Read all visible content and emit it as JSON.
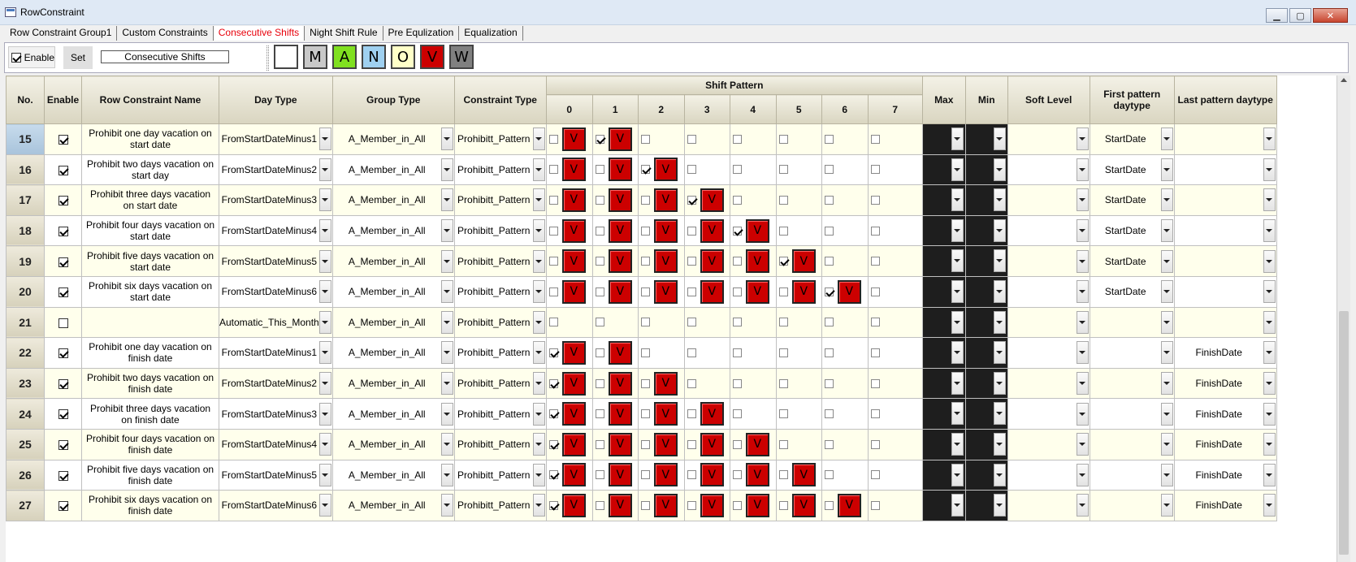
{
  "window": {
    "title": "RowConstraint",
    "minimize": "▁",
    "maximize": "▢",
    "close": "✕"
  },
  "tabs": [
    "Row Constraint Group1",
    "Custom Constraints",
    "Consecutive Shifts",
    "Night Shift Rule",
    "Pre Equlization",
    "Equalization"
  ],
  "active_tab": 2,
  "toolbar": {
    "enable_label": "Enable",
    "enable_checked": true,
    "set_label": "Set",
    "name_value": "Consecutive Shifts",
    "shift_buttons": [
      {
        "label": "",
        "color": "#ffffff"
      },
      {
        "label": "M",
        "color": "#c8c8c8"
      },
      {
        "label": "A",
        "color": "#80e020"
      },
      {
        "label": "N",
        "color": "#9fd0f0"
      },
      {
        "label": "O",
        "color": "#ffffc8"
      },
      {
        "label": "V",
        "color": "#cc0000"
      },
      {
        "label": "W",
        "color": "#808080"
      }
    ]
  },
  "columns": {
    "no": "No.",
    "enable": "Enable",
    "name": "Row Constraint Name",
    "day_type": "Day Type",
    "group_type": "Group Type",
    "constraint_type": "Constraint Type",
    "shift_pattern": "Shift Pattern",
    "pattern_indices": [
      "0",
      "1",
      "2",
      "3",
      "4",
      "5",
      "6",
      "7"
    ],
    "max": "Max",
    "min": "Min",
    "soft_level": "Soft Level",
    "first_pattern": "First pattern daytype",
    "last_pattern": "Last pattern daytype"
  },
  "rows": [
    {
      "no": "15",
      "enable": true,
      "name": "Prohibit one day vacation on start date",
      "day_type": "FromStartDateMinus1",
      "group": "A_Member_in_All",
      "ctype": "Prohibitt_Pattern",
      "checks": [
        false,
        true,
        false,
        false,
        false,
        false,
        false,
        false
      ],
      "vs": [
        true,
        true,
        false,
        false,
        false,
        false,
        false,
        false
      ],
      "first": "StartDate",
      "last": "",
      "selected": true
    },
    {
      "no": "16",
      "enable": true,
      "name": "Prohibit two days vacation on start day",
      "day_type": "FromStartDateMinus2",
      "group": "A_Member_in_All",
      "ctype": "Prohibitt_Pattern",
      "checks": [
        false,
        false,
        true,
        false,
        false,
        false,
        false,
        false
      ],
      "vs": [
        true,
        true,
        true,
        false,
        false,
        false,
        false,
        false
      ],
      "first": "StartDate",
      "last": ""
    },
    {
      "no": "17",
      "enable": true,
      "name": "Prohibit three days vacation on start date",
      "day_type": "FromStartDateMinus3",
      "group": "A_Member_in_All",
      "ctype": "Prohibitt_Pattern",
      "checks": [
        false,
        false,
        false,
        true,
        false,
        false,
        false,
        false
      ],
      "vs": [
        true,
        true,
        true,
        true,
        false,
        false,
        false,
        false
      ],
      "first": "StartDate",
      "last": ""
    },
    {
      "no": "18",
      "enable": true,
      "name": "Prohibit four days vacation on start date",
      "day_type": "FromStartDateMinus4",
      "group": "A_Member_in_All",
      "ctype": "Prohibitt_Pattern",
      "checks": [
        false,
        false,
        false,
        false,
        true,
        false,
        false,
        false
      ],
      "vs": [
        true,
        true,
        true,
        true,
        true,
        false,
        false,
        false
      ],
      "first": "StartDate",
      "last": ""
    },
    {
      "no": "19",
      "enable": true,
      "name": "Prohibit five days vacation on start date",
      "day_type": "FromStartDateMinus5",
      "group": "A_Member_in_All",
      "ctype": "Prohibitt_Pattern",
      "checks": [
        false,
        false,
        false,
        false,
        false,
        true,
        false,
        false
      ],
      "vs": [
        true,
        true,
        true,
        true,
        true,
        true,
        false,
        false
      ],
      "first": "StartDate",
      "last": ""
    },
    {
      "no": "20",
      "enable": true,
      "name": "Prohibit six days vacation on start date",
      "day_type": "FromStartDateMinus6",
      "group": "A_Member_in_All",
      "ctype": "Prohibitt_Pattern",
      "checks": [
        false,
        false,
        false,
        false,
        false,
        false,
        true,
        false
      ],
      "vs": [
        true,
        true,
        true,
        true,
        true,
        true,
        true,
        false
      ],
      "first": "StartDate",
      "last": ""
    },
    {
      "no": "21",
      "enable": false,
      "name": "",
      "day_type": "Automatic_This_Month",
      "group": "A_Member_in_All",
      "ctype": "Prohibitt_Pattern",
      "checks": [
        false,
        false,
        false,
        false,
        false,
        false,
        false,
        false
      ],
      "vs": [
        false,
        false,
        false,
        false,
        false,
        false,
        false,
        false
      ],
      "first": "",
      "last": ""
    },
    {
      "no": "22",
      "enable": true,
      "name": "Prohibit one day vacation on finish date",
      "day_type": "FromStartDateMinus1",
      "group": "A_Member_in_All",
      "ctype": "Prohibitt_Pattern",
      "checks": [
        true,
        false,
        false,
        false,
        false,
        false,
        false,
        false
      ],
      "vs": [
        true,
        true,
        false,
        false,
        false,
        false,
        false,
        false
      ],
      "first": "",
      "last": "FinishDate"
    },
    {
      "no": "23",
      "enable": true,
      "name": "Prohibit two days vacation on finish date",
      "day_type": "FromStartDateMinus2",
      "group": "A_Member_in_All",
      "ctype": "Prohibitt_Pattern",
      "checks": [
        true,
        false,
        false,
        false,
        false,
        false,
        false,
        false
      ],
      "vs": [
        true,
        true,
        true,
        false,
        false,
        false,
        false,
        false
      ],
      "first": "",
      "last": "FinishDate"
    },
    {
      "no": "24",
      "enable": true,
      "name": "Prohibit three days vacation on finish date",
      "day_type": "FromStartDateMinus3",
      "group": "A_Member_in_All",
      "ctype": "Prohibitt_Pattern",
      "checks": [
        true,
        false,
        false,
        false,
        false,
        false,
        false,
        false
      ],
      "vs": [
        true,
        true,
        true,
        true,
        false,
        false,
        false,
        false
      ],
      "first": "",
      "last": "FinishDate"
    },
    {
      "no": "25",
      "enable": true,
      "name": "Prohibit four days vacation on finish date",
      "day_type": "FromStartDateMinus4",
      "group": "A_Member_in_All",
      "ctype": "Prohibitt_Pattern",
      "checks": [
        true,
        false,
        false,
        false,
        false,
        false,
        false,
        false
      ],
      "vs": [
        true,
        true,
        true,
        true,
        true,
        false,
        false,
        false
      ],
      "first": "",
      "last": "FinishDate"
    },
    {
      "no": "26",
      "enable": true,
      "name": "Prohibit five days vacation on finish date",
      "day_type": "FromStartDateMinus5",
      "group": "A_Member_in_All",
      "ctype": "Prohibitt_Pattern",
      "checks": [
        true,
        false,
        false,
        false,
        false,
        false,
        false,
        false
      ],
      "vs": [
        true,
        true,
        true,
        true,
        true,
        true,
        false,
        false
      ],
      "first": "",
      "last": "FinishDate"
    },
    {
      "no": "27",
      "enable": true,
      "name": "Prohibit six days vacation on finish date",
      "day_type": "FromStartDateMinus6",
      "group": "A_Member_in_All",
      "ctype": "Prohibitt_Pattern",
      "checks": [
        true,
        false,
        false,
        false,
        false,
        false,
        false,
        false
      ],
      "vs": [
        true,
        true,
        true,
        true,
        true,
        true,
        true,
        false
      ],
      "first": "",
      "last": "FinishDate"
    }
  ],
  "v_label": "V"
}
